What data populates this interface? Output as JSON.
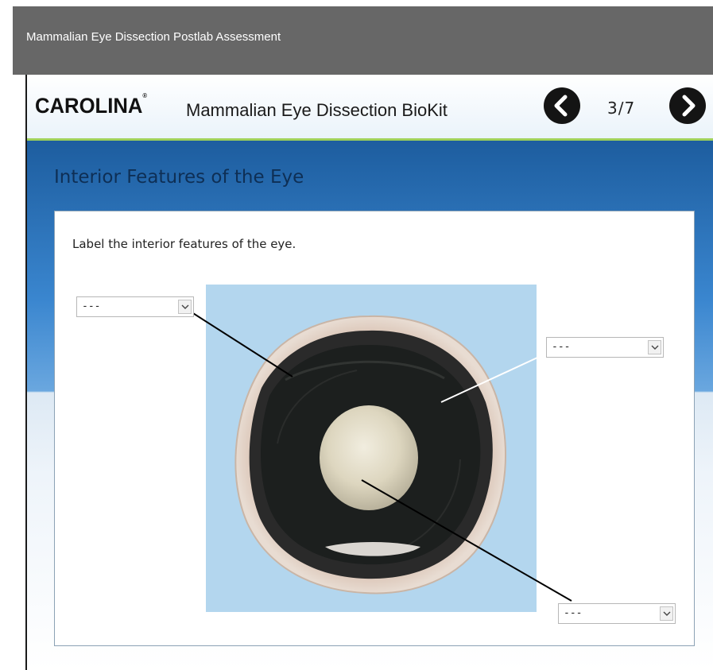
{
  "window": {
    "title": "Mammalian Eye Dissection Postlab Assessment"
  },
  "header": {
    "logo": "CAROLINA",
    "logo_mark": "®",
    "kit_title": "Mammalian Eye Dissection BioKit",
    "page_indicator": "3/7",
    "prev_icon": "chevron-left-icon",
    "next_icon": "chevron-right-icon"
  },
  "section": {
    "title": "Interior Features of the Eye",
    "instruction": "Label the interior features of the eye."
  },
  "labels": [
    {
      "id": "left",
      "value": "---"
    },
    {
      "id": "right",
      "value": "---"
    },
    {
      "id": "bottom",
      "value": "---"
    }
  ],
  "colors": {
    "topbar": "#676767",
    "header_accent": "#9fd15a",
    "content_blue": "#1d5d9f",
    "photo_background": "#b3d6ee",
    "nav_button": "#141414"
  }
}
